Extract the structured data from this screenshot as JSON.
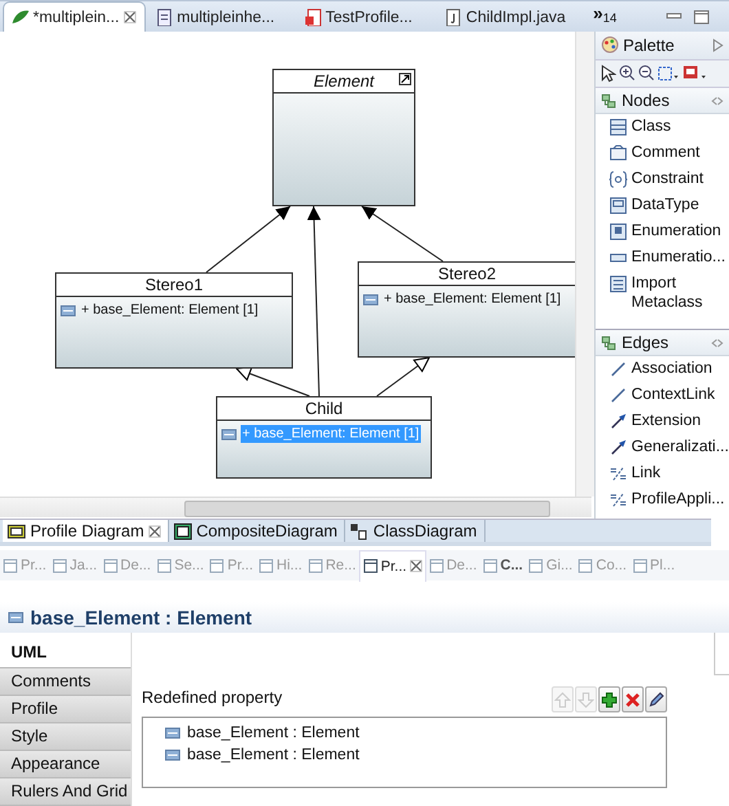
{
  "editor_tabs": [
    {
      "label": "*multiplein...",
      "selected": true
    },
    {
      "label": "multipleinhe...",
      "selected": false
    },
    {
      "label": "TestProfile...",
      "selected": false
    },
    {
      "label": "ChildImpl.java",
      "selected": false
    }
  ],
  "editor_tabs_more": {
    "symbol": "»",
    "count": "14"
  },
  "diagram": {
    "nodes": [
      {
        "name": "Element",
        "abstract": true
      },
      {
        "name": "Stereo1",
        "abstract": false,
        "attributes": [
          {
            "text": "+ base_Element: Element [1]",
            "selected": false
          }
        ]
      },
      {
        "name": "Stereo2",
        "abstract": false,
        "attributes": [
          {
            "text": "+ base_Element: Element [1]",
            "selected": false
          }
        ]
      },
      {
        "name": "Child",
        "abstract": false,
        "attributes": [
          {
            "text": "+ base_Element: Element [1]",
            "selected": true
          }
        ]
      }
    ],
    "edges": [
      {
        "kind": "extension"
      },
      {
        "kind": "extension"
      },
      {
        "kind": "extension"
      },
      {
        "kind": "generalization"
      },
      {
        "kind": "generalization"
      }
    ]
  },
  "palette": {
    "title": "Palette",
    "drawers": [
      {
        "title": "Nodes",
        "items": [
          "Class",
          "Comment",
          "Constraint",
          "DataType",
          "Enumeration",
          "Enumeratio...",
          "Import Metaclass"
        ]
      },
      {
        "title": "Edges",
        "items": [
          "Association",
          "ContextLink",
          "Extension",
          "Generalizati...",
          "Link",
          "ProfileAppli..."
        ]
      }
    ]
  },
  "diagram_tabs": [
    {
      "label": "Profile Diagram",
      "selected": true
    },
    {
      "label": "CompositeDiagram",
      "selected": false
    },
    {
      "label": "ClassDiagram",
      "selected": false
    }
  ],
  "view_tabs": [
    {
      "label": "Pr...",
      "selected": false,
      "bold": false
    },
    {
      "label": "Ja...",
      "selected": false,
      "bold": false
    },
    {
      "label": "De...",
      "selected": false,
      "bold": false
    },
    {
      "label": "Se...",
      "selected": false,
      "bold": false
    },
    {
      "label": "Pr...",
      "selected": false,
      "bold": false
    },
    {
      "label": "Hi...",
      "selected": false,
      "bold": false
    },
    {
      "label": "Re...",
      "selected": false,
      "bold": false
    },
    {
      "label": "Pr...",
      "selected": true,
      "bold": false
    },
    {
      "label": "De...",
      "selected": false,
      "bold": false
    },
    {
      "label": "C...",
      "selected": false,
      "bold": true
    },
    {
      "label": "Gi...",
      "selected": false,
      "bold": false
    },
    {
      "label": "Co...",
      "selected": false,
      "bold": false
    },
    {
      "label": "Pl...",
      "selected": false,
      "bold": false
    }
  ],
  "properties": {
    "title": "base_Element : Element",
    "sections": [
      {
        "label": "UML",
        "selected": true
      },
      {
        "label": "Comments",
        "selected": false
      },
      {
        "label": "Profile",
        "selected": false
      },
      {
        "label": "Style",
        "selected": false
      },
      {
        "label": "Appearance",
        "selected": false
      },
      {
        "label": "Rulers And Grid",
        "selected": false
      }
    ],
    "field_label": "Redefined property",
    "buttons": [
      {
        "kind": "up",
        "disabled": true
      },
      {
        "kind": "down",
        "disabled": true
      },
      {
        "kind": "add",
        "disabled": false
      },
      {
        "kind": "remove",
        "disabled": false
      },
      {
        "kind": "edit",
        "disabled": false
      }
    ],
    "list": [
      "base_Element : Element",
      "base_Element : Element"
    ]
  }
}
